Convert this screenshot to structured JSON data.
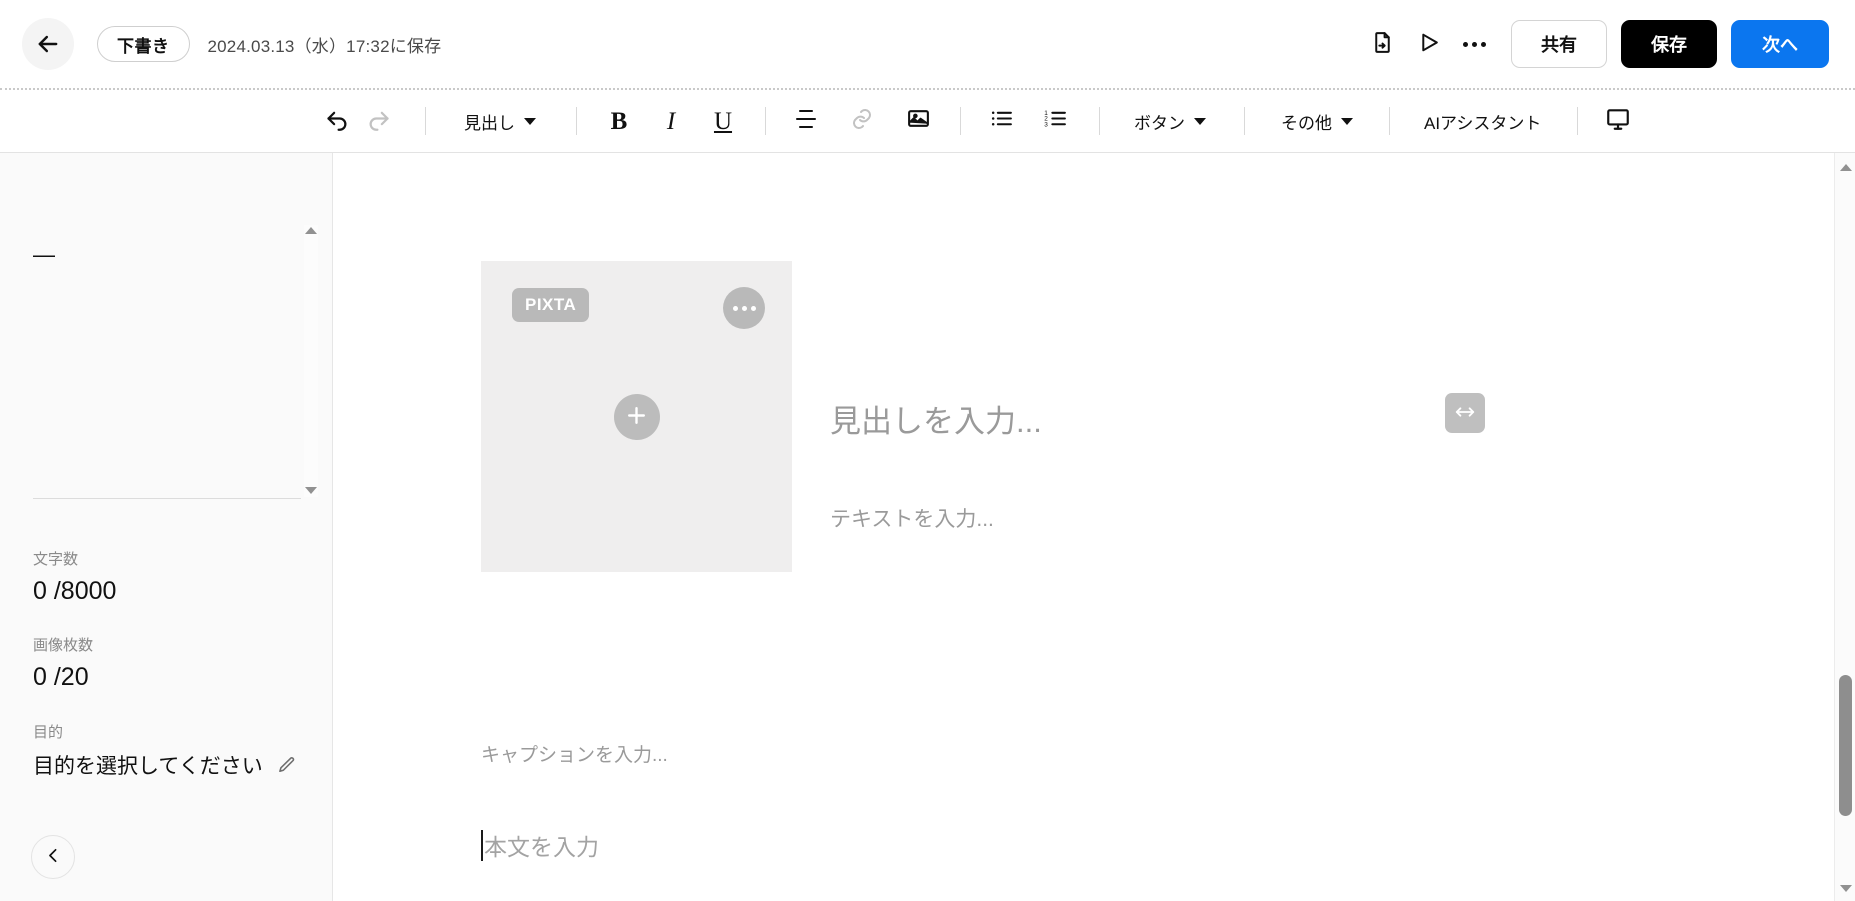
{
  "header": {
    "back_icon": "arrow-left-icon",
    "status_chip": "下書き",
    "saved_text": "2024.03.13（水）17:32に保存",
    "icons": [
      {
        "name": "export-document-icon",
        "label": "下書き出力"
      },
      {
        "name": "preview-play-icon",
        "label": "プレビュー"
      },
      {
        "name": "more-options-icon",
        "label": "その他メニュー"
      }
    ],
    "share_label": "共有",
    "save_label": "保存",
    "next_label": "次へ",
    "next_color": "#0b76ef",
    "save_color": "#000000"
  },
  "toolbar": {
    "undo": "元に戻す",
    "redo": "やり直す",
    "heading_label": "見出し",
    "bold": "B",
    "italic": "I",
    "underline": "U",
    "divider_icon": "horizontal-divider-icon",
    "link_icon": "link-icon",
    "image_icon": "image-icon",
    "bullet_list_icon": "bullet-list-icon",
    "numbered_list_icon": "numbered-list-icon",
    "button_label": "ボタン",
    "other_label": "その他",
    "ai_label": "AIアシスタント",
    "preview_device_icon": "monitor-icon"
  },
  "sidebar": {
    "note_text": "—",
    "char_count": {
      "label": "文字数",
      "value": "0 /8000"
    },
    "image_count": {
      "label": "画像枚数",
      "value": "0 /20"
    },
    "purpose": {
      "label": "目的",
      "value": "目的を選択してください",
      "edit_icon": "pencil-icon"
    },
    "collapse_icon": "chevron-left-icon"
  },
  "canvas": {
    "image_block": {
      "badge": "PIXTA",
      "more_icon": "more-options-icon",
      "add_icon": "plus-icon"
    },
    "caption_placeholder": "キャプションを入力...",
    "heading_placeholder": "見出しを入力...",
    "text_placeholder": "テキストを入力...",
    "body_placeholder": "本文を入力",
    "resize_icon": "resize-horizontal-icon"
  },
  "scrollbars": {
    "sidebar": {
      "up": "scroll-up-arrow",
      "down": "scroll-down-arrow"
    },
    "main": {
      "up": "scroll-up-arrow",
      "down": "scroll-down-arrow",
      "thumb_top_pct": 71,
      "thumb_height_pct": 20
    }
  }
}
